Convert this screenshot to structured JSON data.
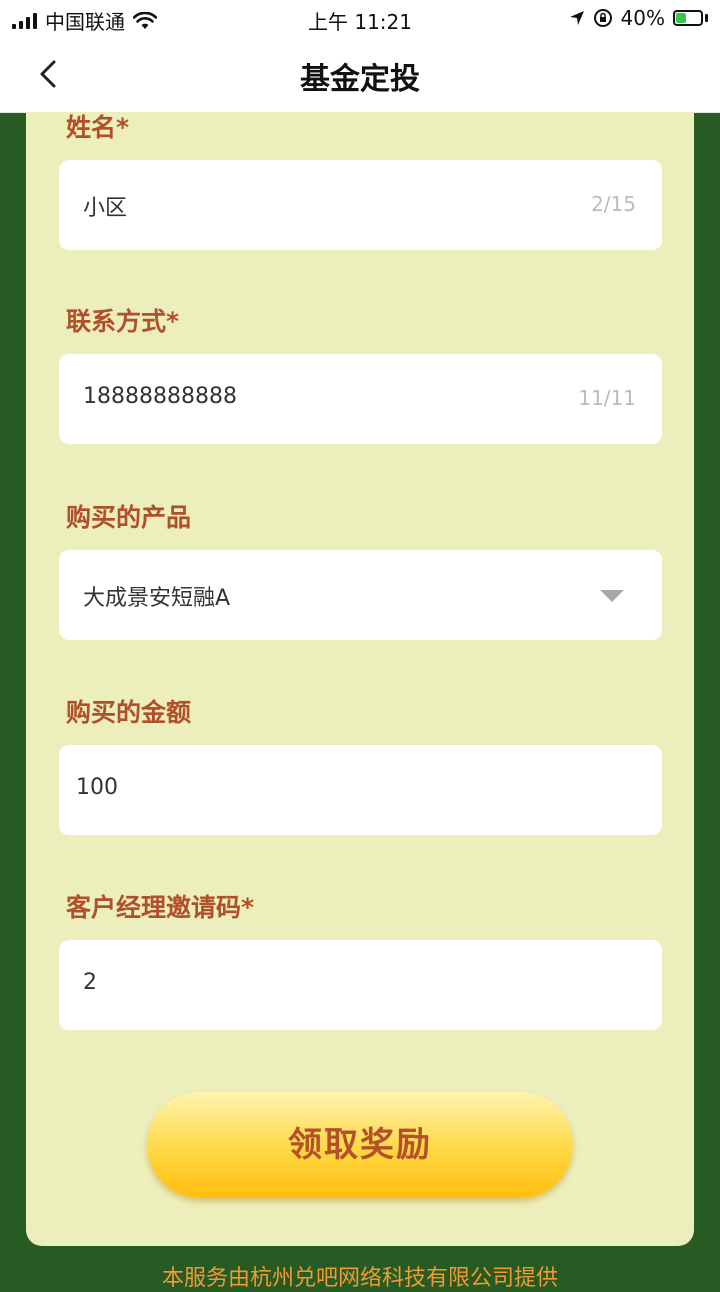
{
  "status": {
    "carrier": "中国联通",
    "time": "上午 11:21",
    "battery_percent": "40%",
    "battery_level": 0.4
  },
  "nav": {
    "title": "基金定投"
  },
  "form": {
    "name": {
      "label": "姓名*",
      "value": "小区",
      "counter": "2/15"
    },
    "contact": {
      "label": "联系方式*",
      "value": "18888888888",
      "counter": "11/11"
    },
    "product": {
      "label": "购买的产品",
      "value": "大成景安短融A"
    },
    "amount": {
      "label": "购买的金额",
      "value": "100"
    },
    "invite": {
      "label": "客户经理邀请码*",
      "value": "2"
    }
  },
  "submit_label": "领取奖励",
  "footer_text": "本服务由杭州兑吧网络科技有限公司提供",
  "colors": {
    "page_bg": "#285b24",
    "card_bg": "#eceebb",
    "label": "#b0502a",
    "button_yellow": "#ffd843",
    "footer": "#f09a30"
  }
}
